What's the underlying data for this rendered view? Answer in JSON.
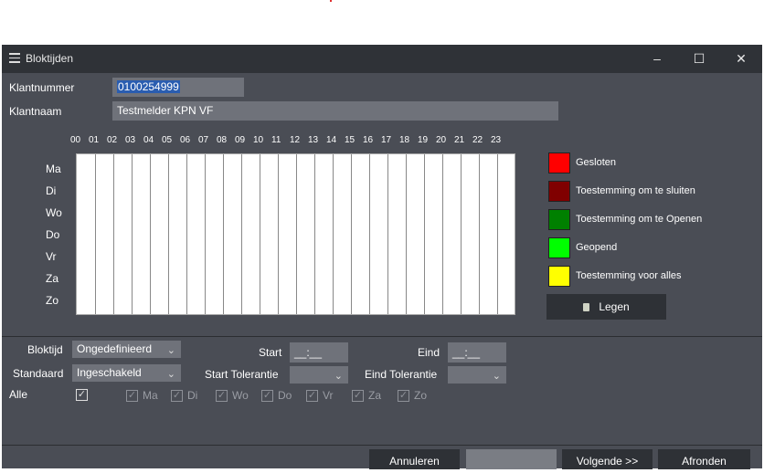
{
  "window": {
    "title": "Bloktijden"
  },
  "header": {
    "klantnummer_label": "Klantnummer",
    "klantnummer_value": "0100254999",
    "klantnaam_label": "Klantnaam",
    "klantnaam_value": "Testmelder KPN VF"
  },
  "hours": [
    "00",
    "01",
    "02",
    "03",
    "04",
    "05",
    "06",
    "07",
    "08",
    "09",
    "10",
    "11",
    "12",
    "13",
    "14",
    "15",
    "16",
    "17",
    "18",
    "19",
    "20",
    "21",
    "22",
    "23"
  ],
  "days": [
    "Ma",
    "Di",
    "Wo",
    "Do",
    "Vr",
    "Za",
    "Zo"
  ],
  "legend": [
    {
      "label": "Gesloten",
      "color": "#ff0000"
    },
    {
      "label": "Toestemming om te sluiten",
      "color": "#800000"
    },
    {
      "label": "Toestemming om te Openen",
      "color": "#008000"
    },
    {
      "label": "Geopend",
      "color": "#00ff00"
    },
    {
      "label": "Toestemming voor alles",
      "color": "#ffff00"
    }
  ],
  "legen_label": "Legen",
  "form": {
    "bloktijd_label": "Bloktijd",
    "bloktijd_value": "Ongedefinieerd",
    "standaard_label": "Standaard",
    "standaard_value": "Ingeschakeld",
    "alle_label": "Alle",
    "start_label": "Start",
    "start_value": "__:__",
    "eind_label": "Eind",
    "eind_value": "__:__",
    "start_tol_label": "Start Tolerantie",
    "eind_tol_label": "Eind Tolerantie"
  },
  "day_checks": [
    "Ma",
    "Di",
    "Wo",
    "Do",
    "Vr",
    "Za",
    "Zo"
  ],
  "buttons": {
    "annuleren": "Annuleren",
    "opslaan": "",
    "volgende": "Volgende >>",
    "afronden": "Afronden"
  }
}
